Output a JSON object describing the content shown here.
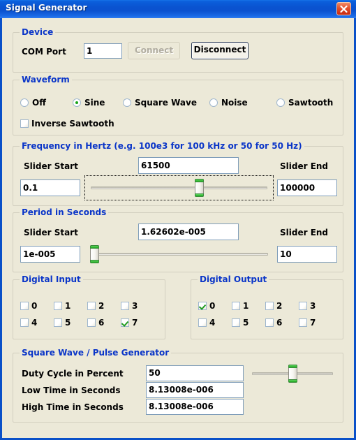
{
  "window": {
    "title": "Signal Generator",
    "close_icon": "close-icon"
  },
  "device": {
    "legend": "Device",
    "com_port_label": "COM Port",
    "com_port_value": "1",
    "connect_label": "Connect",
    "disconnect_label": "Disconnect"
  },
  "waveform": {
    "legend": "Waveform",
    "options": [
      {
        "label": "Off",
        "selected": false
      },
      {
        "label": "Sine",
        "selected": true
      },
      {
        "label": "Square Wave",
        "selected": false
      },
      {
        "label": "Noise",
        "selected": false
      },
      {
        "label": "Sawtooth",
        "selected": false
      }
    ],
    "inverse_sawtooth_label": "Inverse Sawtooth",
    "inverse_sawtooth_checked": false
  },
  "frequency": {
    "legend": "Frequency in Hertz (e.g. 100e3 for 100 kHz or 50 for 50 Hz)",
    "slider_start_label": "Slider Start",
    "slider_start_value": "0.1",
    "value": "61500",
    "slider_end_label": "Slider End",
    "slider_end_value": "100000",
    "slider_percent": 60
  },
  "period": {
    "legend": "Period in Seconds",
    "slider_start_label": "Slider Start",
    "slider_start_value": "1e-005",
    "value": "1.62602e-005",
    "slider_end_label": "Slider End",
    "slider_end_value": "10",
    "slider_percent": 2
  },
  "digital_input": {
    "legend": "Digital Input",
    "channels": [
      {
        "label": "0",
        "checked": false
      },
      {
        "label": "1",
        "checked": false
      },
      {
        "label": "2",
        "checked": false
      },
      {
        "label": "3",
        "checked": false
      },
      {
        "label": "4",
        "checked": false
      },
      {
        "label": "5",
        "checked": false
      },
      {
        "label": "6",
        "checked": false
      },
      {
        "label": "7",
        "checked": true
      }
    ]
  },
  "digital_output": {
    "legend": "Digital Output",
    "channels": [
      {
        "label": "0",
        "checked": true
      },
      {
        "label": "1",
        "checked": false
      },
      {
        "label": "2",
        "checked": false
      },
      {
        "label": "3",
        "checked": false
      },
      {
        "label": "4",
        "checked": false
      },
      {
        "label": "5",
        "checked": false
      },
      {
        "label": "6",
        "checked": false
      },
      {
        "label": "7",
        "checked": false
      }
    ]
  },
  "pulse": {
    "legend": "Square Wave / Pulse Generator",
    "duty_cycle_label": "Duty Cycle in Percent",
    "duty_cycle_value": "50",
    "low_time_label": "Low Time in Seconds",
    "low_time_value": "8.13008e-006",
    "high_time_label": "High Time in Seconds",
    "high_time_value": "8.13008e-006",
    "duty_slider_percent": 50
  },
  "colors": {
    "title_bar": "#0a53d0",
    "legend_text": "#0a35c8",
    "panel_bg": "#ece9d8",
    "accent_green": "#1fa81f",
    "input_border": "#7f9db9"
  }
}
